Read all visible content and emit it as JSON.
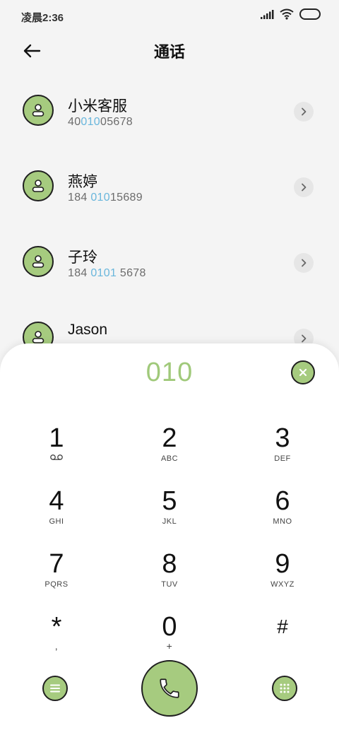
{
  "status_bar": {
    "time": "凌晨2:36"
  },
  "header": {
    "title": "通话"
  },
  "contacts": [
    {
      "name": "小米客服",
      "number_pre": "40",
      "number_hl": "010",
      "number_post": "05678"
    },
    {
      "name": "燕婷",
      "number_pre": "184 ",
      "number_hl": "010",
      "number_post": "15689"
    },
    {
      "name": "子玲",
      "number_pre": "184 ",
      "number_hl": "0101",
      "number_post": " 5678"
    },
    {
      "name": "Jason",
      "number_pre": "",
      "number_hl": "",
      "number_post": ""
    }
  ],
  "dialer": {
    "input": "010",
    "keys": [
      {
        "digit": "1",
        "letters": ""
      },
      {
        "digit": "2",
        "letters": "ABC"
      },
      {
        "digit": "3",
        "letters": "DEF"
      },
      {
        "digit": "4",
        "letters": "GHI"
      },
      {
        "digit": "5",
        "letters": "JKL"
      },
      {
        "digit": "6",
        "letters": "MNO"
      },
      {
        "digit": "7",
        "letters": "PQRS"
      },
      {
        "digit": "8",
        "letters": "TUV"
      },
      {
        "digit": "9",
        "letters": "WXYZ"
      },
      {
        "digit": "*",
        "letters": ","
      },
      {
        "digit": "0",
        "letters": "+"
      },
      {
        "digit": "#",
        "letters": ""
      }
    ]
  },
  "colors": {
    "accent": "#a6cb7f",
    "highlight": "#69b6dc",
    "background": "#f4f4f4",
    "panel": "#ffffff"
  },
  "icons": {
    "back": "back-arrow-icon",
    "avatar": "person-icon",
    "detail": "chevron-right-icon",
    "clear": "close-icon",
    "voicemail": "voicemail-icon",
    "menu": "menu-icon",
    "call": "phone-icon",
    "keypad": "dialpad-icon"
  }
}
